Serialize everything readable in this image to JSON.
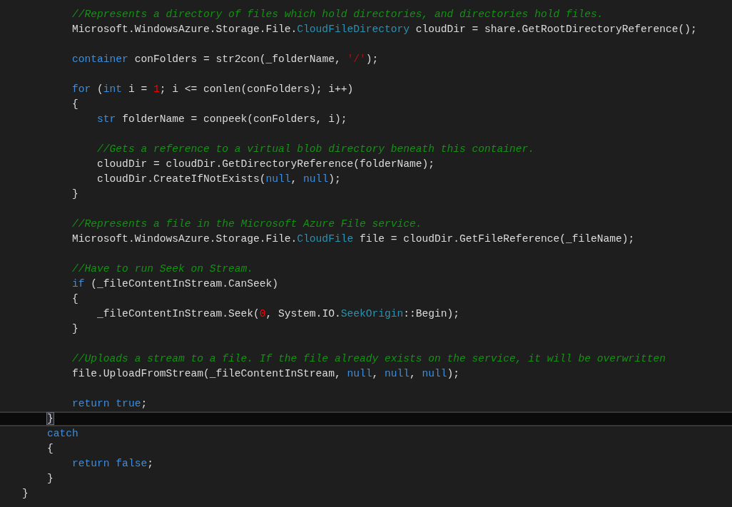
{
  "editor": {
    "lines": [
      {
        "current": false,
        "tokens": [
          {
            "kind": "comment",
            "text": "        //Represents a directory of files which hold directories, and directories hold files."
          }
        ]
      },
      {
        "current": false,
        "tokens": [
          {
            "kind": "plain",
            "text": "        Microsoft.WindowsAzure.Storage.File."
          },
          {
            "kind": "type",
            "text": "CloudFileDirectory"
          },
          {
            "kind": "plain",
            "text": " cloudDir = share.GetRootDirectoryReference();"
          }
        ]
      },
      {
        "current": false
      },
      {
        "current": false,
        "tokens": [
          {
            "kind": "keyword",
            "text": "        container"
          },
          {
            "kind": "plain",
            "text": " conFolders = str2con(_folderName, "
          },
          {
            "kind": "string",
            "text": "'/'"
          },
          {
            "kind": "plain",
            "text": ");"
          }
        ]
      },
      {
        "current": false
      },
      {
        "current": false,
        "tokens": [
          {
            "kind": "keyword",
            "text": "        for"
          },
          {
            "kind": "plain",
            "text": " ("
          },
          {
            "kind": "keyword",
            "text": "int"
          },
          {
            "kind": "plain",
            "text": " i = "
          },
          {
            "kind": "number",
            "text": "1"
          },
          {
            "kind": "plain",
            "text": "; i <= conlen(conFolders); i++)"
          }
        ]
      },
      {
        "current": false,
        "tokens": [
          {
            "kind": "plain",
            "text": "        {"
          }
        ]
      },
      {
        "current": false,
        "tokens": [
          {
            "kind": "keyword",
            "text": "            str"
          },
          {
            "kind": "plain",
            "text": " folderName = conpeek(conFolders, i);"
          }
        ]
      },
      {
        "current": false
      },
      {
        "current": false,
        "tokens": [
          {
            "kind": "comment",
            "text": "            //Gets a reference to a virtual blob directory beneath this container."
          }
        ]
      },
      {
        "current": false,
        "tokens": [
          {
            "kind": "plain",
            "text": "            cloudDir = cloudDir.GetDirectoryReference(folderName);"
          }
        ]
      },
      {
        "current": false,
        "tokens": [
          {
            "kind": "plain",
            "text": "            cloudDir.CreateIfNotExists("
          },
          {
            "kind": "keyword",
            "text": "null"
          },
          {
            "kind": "plain",
            "text": ", "
          },
          {
            "kind": "keyword",
            "text": "null"
          },
          {
            "kind": "plain",
            "text": ");"
          }
        ]
      },
      {
        "current": false,
        "tokens": [
          {
            "kind": "plain",
            "text": "        }"
          }
        ]
      },
      {
        "current": false
      },
      {
        "current": false,
        "tokens": [
          {
            "kind": "comment",
            "text": "        //Represents a file in the Microsoft Azure File service."
          }
        ]
      },
      {
        "current": false,
        "tokens": [
          {
            "kind": "plain",
            "text": "        Microsoft.WindowsAzure.Storage.File."
          },
          {
            "kind": "type",
            "text": "CloudFile"
          },
          {
            "kind": "plain",
            "text": " file = cloudDir.GetFileReference(_fileName);"
          }
        ]
      },
      {
        "current": false
      },
      {
        "current": false,
        "tokens": [
          {
            "kind": "comment",
            "text": "        //Have to run Seek on Stream."
          }
        ]
      },
      {
        "current": false,
        "tokens": [
          {
            "kind": "keyword",
            "text": "        if"
          },
          {
            "kind": "plain",
            "text": " (_fileContentInStream.CanSeek)"
          }
        ]
      },
      {
        "current": false,
        "tokens": [
          {
            "kind": "plain",
            "text": "        {"
          }
        ]
      },
      {
        "current": false,
        "tokens": [
          {
            "kind": "plain",
            "text": "            _fileContentInStream.Seek("
          },
          {
            "kind": "number",
            "text": "0"
          },
          {
            "kind": "plain",
            "text": ", System.IO."
          },
          {
            "kind": "type",
            "text": "SeekOrigin"
          },
          {
            "kind": "plain",
            "text": "::Begin);"
          }
        ]
      },
      {
        "current": false,
        "tokens": [
          {
            "kind": "plain",
            "text": "        }"
          }
        ]
      },
      {
        "current": false
      },
      {
        "current": false,
        "tokens": [
          {
            "kind": "comment",
            "text": "        //Uploads a stream to a file. If the file already exists on the service, it will be overwritten"
          }
        ]
      },
      {
        "current": false,
        "tokens": [
          {
            "kind": "plain",
            "text": "        file.UploadFromStream(_fileContentInStream, "
          },
          {
            "kind": "keyword",
            "text": "null"
          },
          {
            "kind": "plain",
            "text": ", "
          },
          {
            "kind": "keyword",
            "text": "null"
          },
          {
            "kind": "plain",
            "text": ", "
          },
          {
            "kind": "keyword",
            "text": "null"
          },
          {
            "kind": "plain",
            "text": ");"
          }
        ]
      },
      {
        "current": false
      },
      {
        "current": false,
        "tokens": [
          {
            "kind": "keyword",
            "text": "        return true"
          },
          {
            "kind": "plain",
            "text": ";"
          }
        ]
      },
      {
        "current": true,
        "tokens": [
          {
            "kind": "matched_brace",
            "text": "    }"
          }
        ]
      },
      {
        "current": false,
        "tokens": [
          {
            "kind": "keyword",
            "text": "    catch"
          }
        ]
      },
      {
        "current": false,
        "tokens": [
          {
            "kind": "plain",
            "text": "    {"
          }
        ]
      },
      {
        "current": false,
        "tokens": [
          {
            "kind": "keyword",
            "text": "        return false"
          },
          {
            "kind": "plain",
            "text": ";"
          }
        ]
      },
      {
        "current": false,
        "tokens": [
          {
            "kind": "plain",
            "text": "    }"
          }
        ]
      },
      {
        "current": false,
        "tokens": [
          {
            "kind": "plain",
            "text": "}"
          }
        ]
      }
    ]
  }
}
